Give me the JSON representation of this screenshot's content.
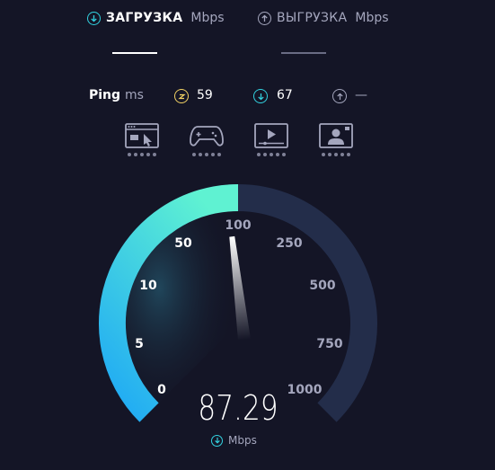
{
  "tabs": [
    {
      "title": "ЗАГРУЗКА",
      "unit": "Mbps",
      "icon": "download-arrow-icon",
      "active": true
    },
    {
      "title": "ВЫГРУЗКА",
      "unit": "Mbps",
      "icon": "upload-arrow-icon",
      "active": false
    }
  ],
  "ping": {
    "label": "Ping",
    "unit": "ms",
    "idle_value": "59",
    "download_value": "67",
    "upload_value": "—"
  },
  "activities": [
    {
      "icon": "web-browsing-icon",
      "rating": 5
    },
    {
      "icon": "gaming-controller-icon",
      "rating": 5
    },
    {
      "icon": "video-streaming-icon",
      "rating": 5
    },
    {
      "icon": "video-call-icon",
      "rating": 5
    }
  ],
  "gauge": {
    "ticks": [
      "0",
      "5",
      "10",
      "50",
      "100",
      "250",
      "500",
      "750",
      "1000"
    ],
    "value": "87.29",
    "unit": "Mbps",
    "fill_fraction": 0.5
  },
  "colors": {
    "background": "#141526",
    "accent_cyan": "#32d2e0",
    "gauge_track": "#232d4a",
    "gauge_start": "#1ea8f5",
    "gauge_end": "#5ff2d2"
  }
}
